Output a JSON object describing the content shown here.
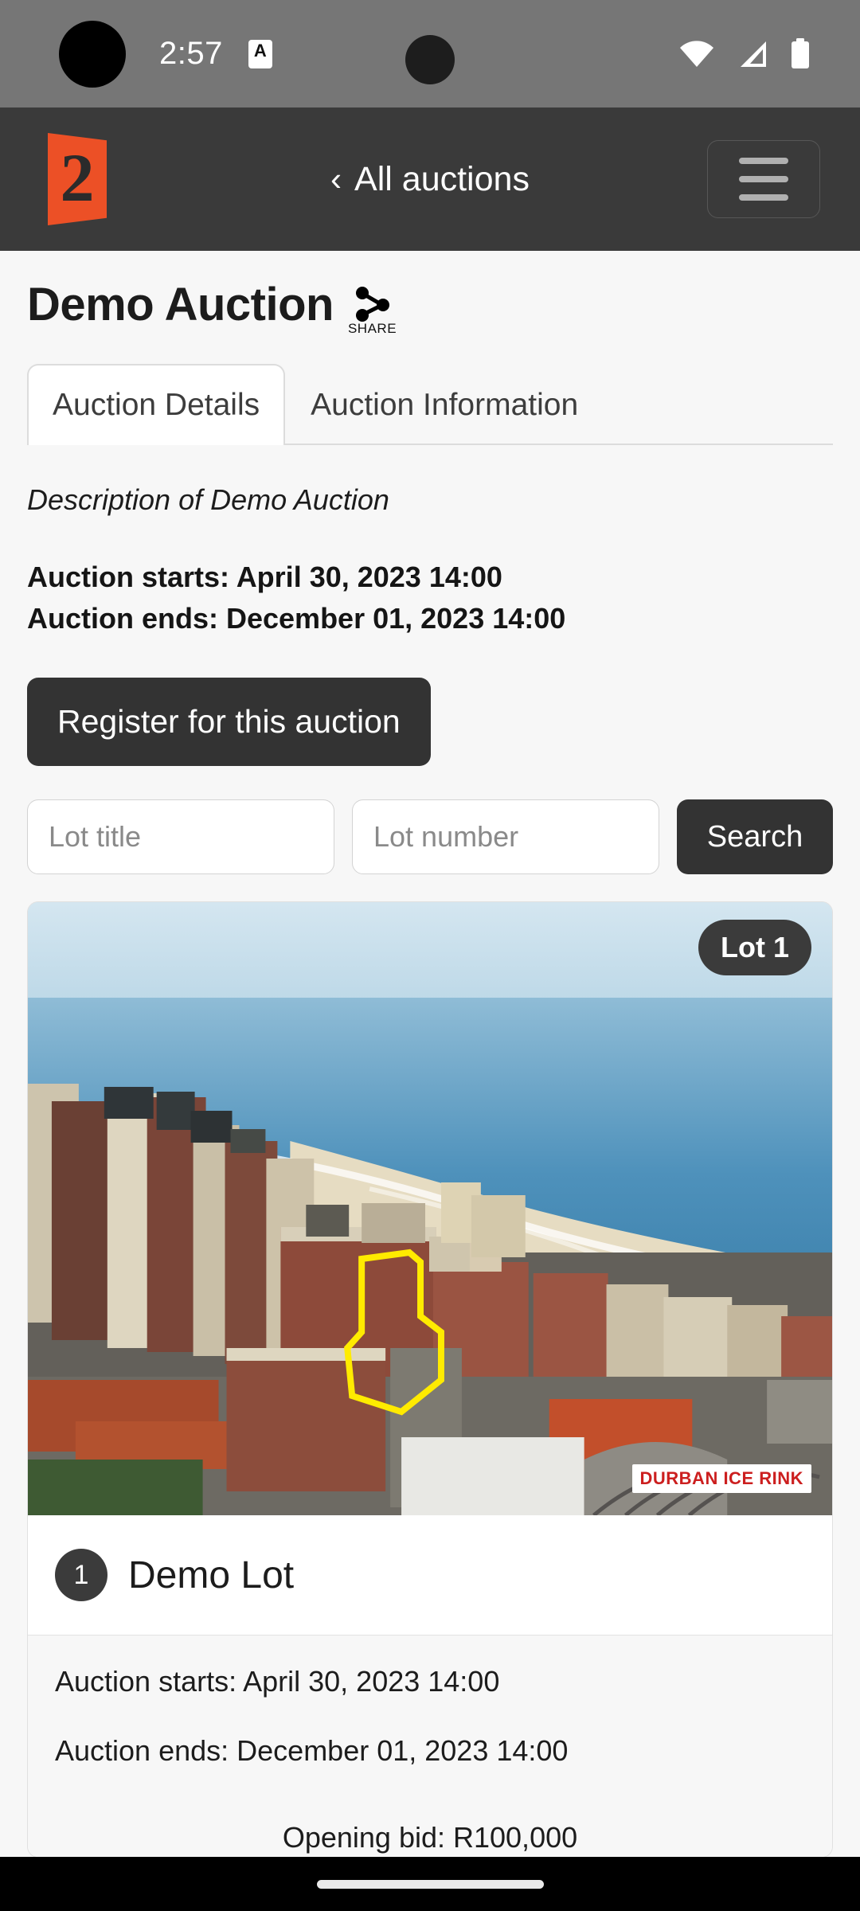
{
  "status_bar": {
    "time": "2:57",
    "app_icon_letter": "A",
    "icons": [
      "camera-punch-hole",
      "a-badge-icon",
      "wifi-icon",
      "cellular-signal-icon",
      "battery-icon"
    ]
  },
  "app_bar": {
    "logo_text": "2",
    "logo_color": "#ec5026",
    "back_label": "All auctions",
    "back_chevron": "‹",
    "menu_icon": "hamburger-menu-icon"
  },
  "page": {
    "title": "Demo Auction",
    "share_label": "SHARE",
    "share_icon": "share-icon"
  },
  "tabs": [
    {
      "label": "Auction Details",
      "active": true
    },
    {
      "label": "Auction Information",
      "active": false
    }
  ],
  "details": {
    "description": "Description of Demo Auction",
    "starts": "Auction starts: April 30, 2023 14:00",
    "ends": "Auction ends: December 01, 2023 14:00",
    "register_label": "Register for this auction"
  },
  "search": {
    "lot_title_placeholder": "Lot title",
    "lot_title_value": "",
    "lot_number_placeholder": "Lot number",
    "lot_number_value": "",
    "search_label": "Search"
  },
  "lot": {
    "badge": "Lot 1",
    "number": "1",
    "name": "Demo Lot",
    "photo_caption": "DURBAN ICE RINK",
    "starts": "Auction starts: April 30, 2023 14:00",
    "ends": "Auction ends: December 01, 2023 14:00",
    "opening_bid": "Opening bid: R100,000",
    "highlight_color": "#ffeb00"
  },
  "colors": {
    "accent": "#ec5026",
    "dark_button": "#333333",
    "app_bar": "#3a3a3a",
    "status_bar": "#767676",
    "page_bg": "#f7f7f7"
  }
}
